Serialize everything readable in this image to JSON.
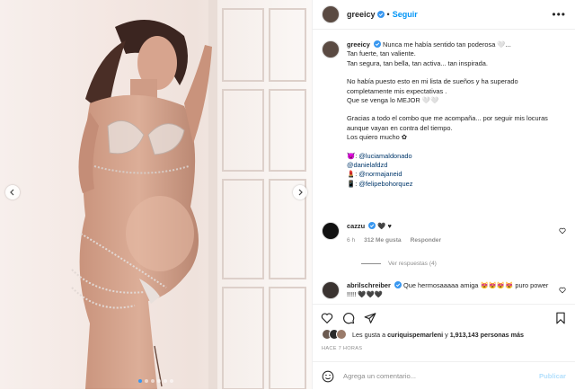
{
  "post": {
    "username": "greeicy",
    "follow_label": "Seguir",
    "verified": true
  },
  "caption": {
    "username": "greeicy",
    "lines": [
      "Nunca me había sentido tan poderosa 🤍...",
      "Tan fuerte, tan valiente.",
      "Tan segura, tan bella, tan activa... tan inspirada.",
      "",
      "No había puesto esto en mi lista de sueños y ha superado",
      "completamente mis expectativas .",
      "Que se venga lo MEJOR 🤍🤍",
      "",
      "Gracias a todo el combo que me acompaña... por seguir mis locuras",
      "aunque vayan en contra del tiempo.",
      "Los quiero mucho ✿",
      ""
    ],
    "credits": [
      {
        "emoji": "😈:",
        "mention": "@luciamaldonado"
      },
      {
        "emoji": "",
        "mention": "@danielafdzd"
      },
      {
        "emoji": "💄:",
        "mention": "@normajaneid"
      },
      {
        "emoji": "📱:",
        "mention": "@felipebohorquez"
      }
    ]
  },
  "comments": [
    {
      "username": "cazzu",
      "text": "🖤 ♥",
      "time": "6 h",
      "likes": "312 Me gusta",
      "reply": "Responder",
      "view_replies": "Ver respuestas (4)"
    },
    {
      "username": "abrilschreiber",
      "text": "Que hermosaaaaa amiga 😻😻😻😻 puro power !!!!! 🖤🖤🖤"
    }
  ],
  "likes": {
    "prefix": "Les gusta a",
    "user": "curiquispemarleni",
    "joiner": "y",
    "count": "1,913,143 personas más"
  },
  "time_ago": "HACE 7 HORAS",
  "add_comment": {
    "placeholder": "Agrega un comentario...",
    "publish_label": "Publicar"
  },
  "carousel": {
    "slides": 6,
    "active_index": 0
  },
  "colors": {
    "link": "#0095f6",
    "mention": "#00376b",
    "verified": "#3897f0",
    "muted": "#8e8e8e",
    "border": "#efefef"
  },
  "icons": [
    "verified-icon",
    "more-options-icon",
    "heart-icon",
    "comment-icon",
    "share-icon",
    "bookmark-icon",
    "emoji-icon",
    "chevron-left-icon",
    "chevron-right-icon"
  ]
}
